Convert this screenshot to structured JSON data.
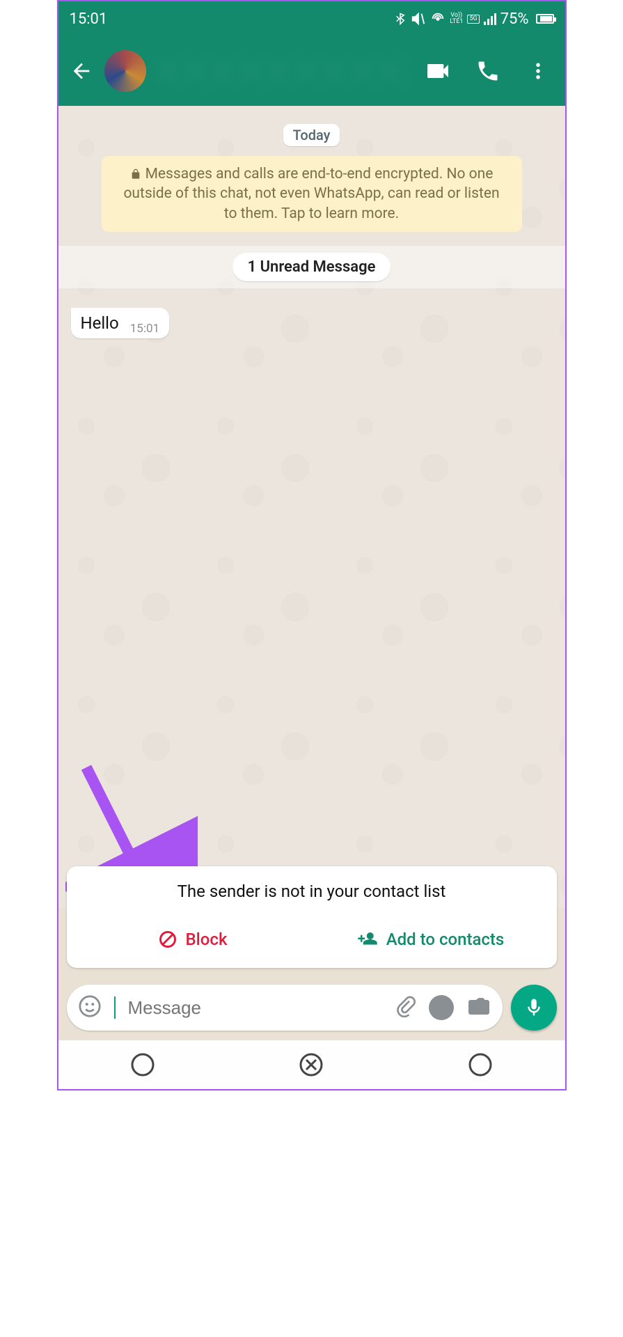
{
  "status_bar": {
    "time": "15:01",
    "battery_percent": "75%",
    "network_label_top": "5G",
    "network_label_bottom": "LTE1",
    "volte": "Vo))"
  },
  "header": {
    "contact_name_placeholder": "",
    "icons": {
      "back": "back-arrow-icon",
      "video": "video-call-icon",
      "call": "voice-call-icon",
      "more": "more-options-icon"
    }
  },
  "chat": {
    "date_label": "Today",
    "encryption_notice": "Messages and calls are end-to-end encrypted. No one outside of this chat, not even WhatsApp, can read or listen to them. Tap to learn more.",
    "unread_divider": "1 Unread Message",
    "messages": [
      {
        "direction": "in",
        "text": "Hello",
        "time": "15:01"
      }
    ]
  },
  "sender_card": {
    "message": "The sender is not in your contact list",
    "block_label": "Block",
    "add_label": "Add to contacts"
  },
  "composer": {
    "placeholder": "Message"
  },
  "colors": {
    "brand": "#138a6c",
    "danger": "#e11b3c",
    "annotation": "#a854f3"
  }
}
